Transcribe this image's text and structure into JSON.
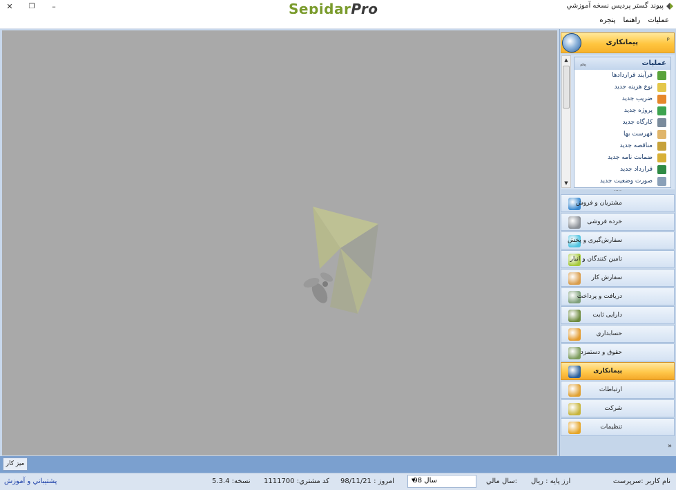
{
  "window": {
    "brand_part1": "Sepidar",
    "brand_part2": "Pro",
    "title": "پیوند گستر پردیس نسخه آموزشي",
    "controls": {
      "close": "✕",
      "restore": "❐",
      "minimize": "–"
    }
  },
  "menu": {
    "items": [
      "عملیات",
      "راهنما",
      "پنجره"
    ]
  },
  "panel": {
    "header_title": "پیمانکاری",
    "pin": "ᵖ",
    "ops_title": "عملیات",
    "ops_items": [
      {
        "label": "فرآیند قراردادها",
        "color": "#5aa33a"
      },
      {
        "label": "نوع هزینه جدید",
        "color": "#e4c74a"
      },
      {
        "label": "ضریب جدید",
        "color": "#e6872a"
      },
      {
        "label": "پروژه جدید",
        "color": "#3da34f"
      },
      {
        "label": "کارگاه جدید",
        "color": "#7a8b9c"
      },
      {
        "label": "فهرست بها",
        "color": "#e0b56a"
      },
      {
        "label": "مناقصه جدید",
        "color": "#c7a23a"
      },
      {
        "label": "ضمانت نامه جدید",
        "color": "#d8b036"
      },
      {
        "label": "قرارداد جدید",
        "color": "#2f8a44"
      },
      {
        "label": "صورت وضعیت جدید",
        "color": "#8aa0b8"
      }
    ],
    "nav_items": [
      {
        "label": "مشتریان و فروش",
        "color": "#3b8ad0",
        "active": false
      },
      {
        "label": "خرده فروشی",
        "color": "#8a8f96",
        "active": false
      },
      {
        "label": "سفارش‌گیری و پخش",
        "color": "#4ec3e0",
        "active": false
      },
      {
        "label": "تامین کنندگان و انبار",
        "color": "#a5c93a",
        "active": false
      },
      {
        "label": "سفارش کار",
        "color": "#d99c4a",
        "active": false
      },
      {
        "label": "دریافت و پرداخت",
        "color": "#7fa07a",
        "active": false
      },
      {
        "label": "دارایی ثابت",
        "color": "#6d8a3e",
        "active": false
      },
      {
        "label": "حسابداری",
        "color": "#e39a2c",
        "active": false
      },
      {
        "label": "حقوق و دستمزد",
        "color": "#7a9a5a",
        "active": false
      },
      {
        "label": "پیمانکاری",
        "color": "#2a5f9b",
        "active": true
      },
      {
        "label": "ارتباطات",
        "color": "#e0a030",
        "active": false
      },
      {
        "label": "شرکت",
        "color": "#c7b43a",
        "active": false
      },
      {
        "label": "تنظیمات",
        "color": "#e5a528",
        "active": false
      }
    ],
    "more": "»"
  },
  "tabs": {
    "desktop": "میز کار"
  },
  "status": {
    "username": "نام کاربر :سرپرست",
    "base_currency": "ارز پایه :   ریال",
    "fiscal_year_label": "سال مالي:",
    "fiscal_year_value": "سال 98",
    "today": "امروز :   98/11/21",
    "customer_code": "کد مشتري:   1111700",
    "version": "نسخه:   5.3.4",
    "support": "پشتيباني و آموزش"
  }
}
